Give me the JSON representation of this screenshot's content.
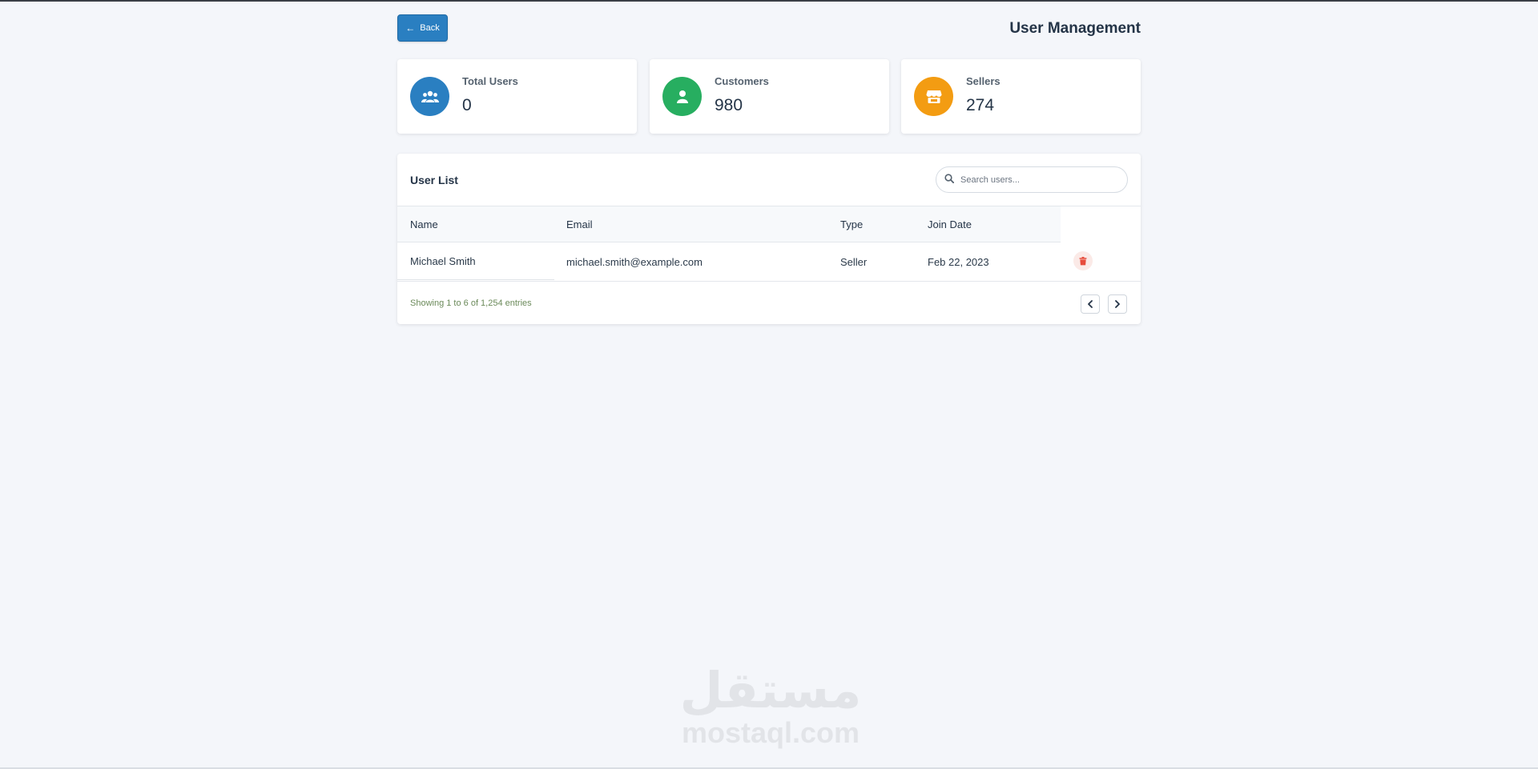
{
  "header": {
    "back_label": "Back",
    "title": "User Management"
  },
  "stats": [
    {
      "label": "Total Users",
      "value": "0",
      "color": "#2a7fc1",
      "icon": "users-icon"
    },
    {
      "label": "Customers",
      "value": "980",
      "color": "#27ae60",
      "icon": "user-icon"
    },
    {
      "label": "Sellers",
      "value": "274",
      "color": "#f39c12",
      "icon": "store-icon"
    }
  ],
  "user_list": {
    "title": "User List",
    "search_placeholder": "Search users...",
    "columns": [
      "Name",
      "Email",
      "Type",
      "Join Date"
    ],
    "rows": [
      {
        "name": "Michael Smith",
        "email": "michael.smith@example.com",
        "type": "Seller",
        "join_date": "Feb 22, 2023"
      }
    ],
    "footer": "Showing 1 to 6 of 1,254 entries"
  },
  "watermark": {
    "arabic": "مستقل",
    "latin": "mostaql.com"
  },
  "colors": {
    "accent": "#2a7fc1",
    "delete": "#e74c3c"
  }
}
